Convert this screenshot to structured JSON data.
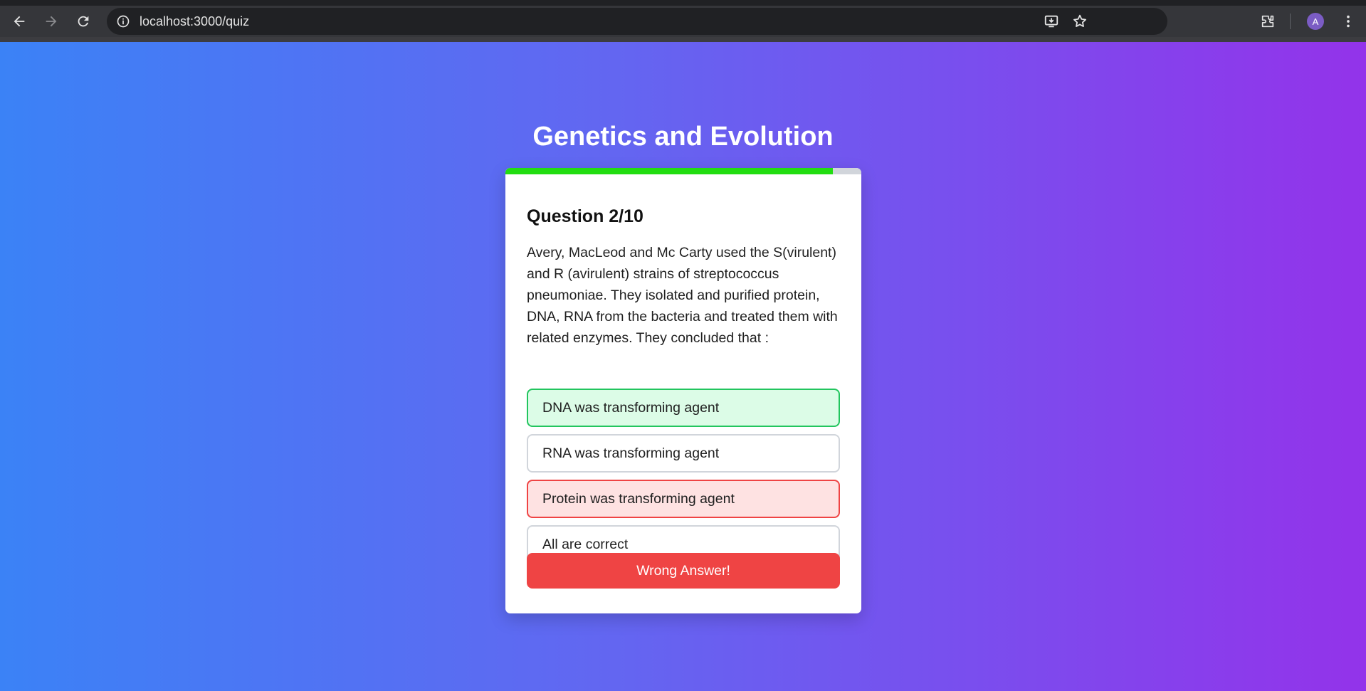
{
  "browser": {
    "url": "localhost:3000/quiz",
    "profile_initial": "A",
    "icons": [
      "back-icon",
      "forward-icon",
      "reload-icon",
      "site-info-icon",
      "install-app-icon",
      "bookmark-star-icon",
      "extensions-icon",
      "menu-dots-icon"
    ]
  },
  "quiz": {
    "title": "Genetics and Evolution",
    "progress_fraction": 0.92,
    "question_header": "Question 2/10",
    "question_text": "Avery, MacLeod and Mc Carty used the S(virulent) and R (avirulent) strains of streptococcus pneumoniae. They isolated and purified protein, DNA, RNA from the bacteria and treated them with related enzymes. They concluded that :",
    "options": [
      {
        "label": "DNA was transforming agent",
        "state": "correct"
      },
      {
        "label": "RNA was transforming agent",
        "state": "neutral"
      },
      {
        "label": "Protein was transforming agent",
        "state": "wrong"
      },
      {
        "label": "All are correct",
        "state": "neutral"
      }
    ],
    "result_label": "Wrong Answer!"
  },
  "colors": {
    "gradient_start": "#3b82f6",
    "gradient_mid": "#6366f1",
    "gradient_end": "#9333ea",
    "progress": "#22dd11",
    "correct_border": "#22c55e",
    "correct_bg": "#dcfce7",
    "wrong_border": "#ef4444",
    "wrong_bg": "#fee2e2",
    "button": "#ef4444"
  }
}
